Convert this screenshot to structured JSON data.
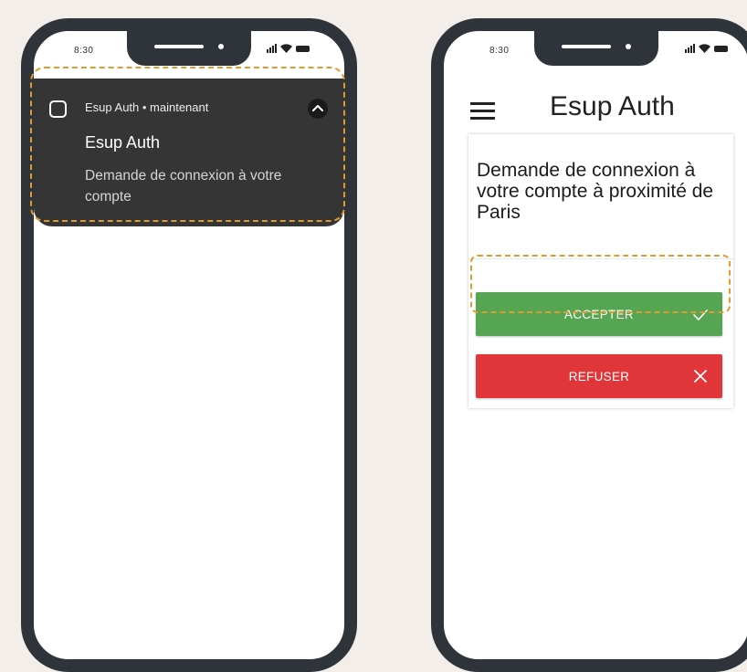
{
  "left_phone": {
    "status_time": "8:30",
    "notification": {
      "app_line": "Esup Auth • maintenant",
      "title": "Esup Auth",
      "body": "Demande de connexion à votre compte"
    }
  },
  "right_phone": {
    "status_time": "8:30",
    "app_title": "Esup Auth",
    "request_message": "Demande de connexion à votre compte à proximité de Paris",
    "accept_label": "ACCEPTER",
    "refuse_label": "REFUSER"
  },
  "icons": {
    "app_icon": "square-ring-icon",
    "expand": "chevron-up-icon",
    "menu": "hamburger-menu-icon",
    "accept": "check-icon",
    "refuse": "close-icon",
    "signal": "signal-icon",
    "wifi": "wifi-icon",
    "battery": "battery-icon"
  },
  "colors": {
    "background": "#f3eeea",
    "phone_frame": "#2e3439",
    "notification_bg": "#353535",
    "highlight": "#e39a2b",
    "accept": "#56a553",
    "refuse": "#e0363a"
  }
}
